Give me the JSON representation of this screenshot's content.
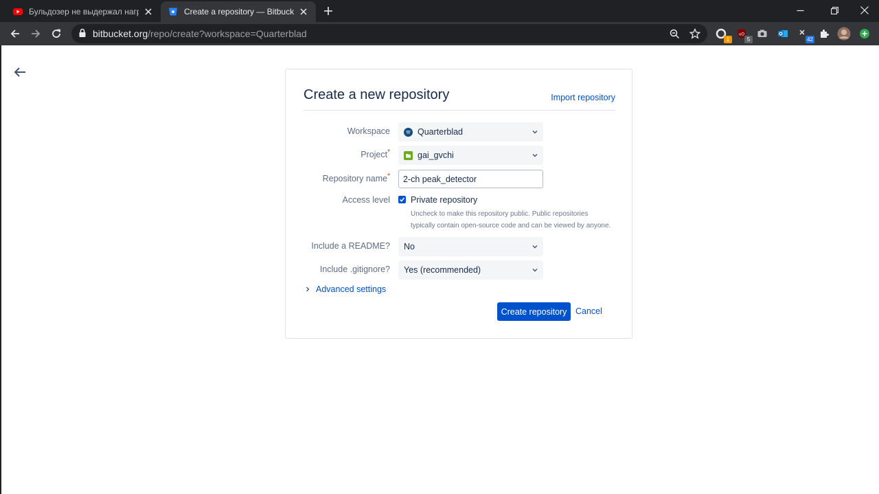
{
  "browser": {
    "tabs": [
      {
        "title": "Бульдозер не выдержал нагрузку",
        "active": false,
        "favicon": "youtube-icon"
      },
      {
        "title": "Create a repository — Bitbucket",
        "active": true,
        "favicon": "bitbucket-icon"
      }
    ],
    "url": {
      "host": "bitbucket.org",
      "path": "/repo/create?workspace=Quarterblad"
    },
    "extensions": [
      {
        "name": "extension-icon-1",
        "badge": "1"
      },
      {
        "name": "ublock-icon",
        "badge": "5"
      },
      {
        "name": "camera-icon",
        "badge": ""
      },
      {
        "name": "outlook-icon",
        "badge": ""
      },
      {
        "name": "extension-icon-42",
        "badge": "42"
      }
    ]
  },
  "form": {
    "title": "Create a new repository",
    "import_link": "Import repository",
    "workspace": {
      "label": "Workspace",
      "value": "Quarterblad"
    },
    "project": {
      "label": "Project",
      "value": "gai_gvchi",
      "required_mark": "*"
    },
    "repo_name": {
      "label": "Repository name",
      "value": "2-ch peak_detector",
      "required_mark": "*"
    },
    "access": {
      "label": "Access level",
      "checkbox_label": "Private repository",
      "checked": true,
      "help_line1": "Uncheck to make this repository public. Public repositories",
      "help_line2": "typically contain open-source code and can be viewed by anyone."
    },
    "readme": {
      "label": "Include a README?",
      "value": "No"
    },
    "gitignore": {
      "label": "Include .gitignore?",
      "value": "Yes (recommended)"
    },
    "advanced": "Advanced settings",
    "submit": "Create repository",
    "cancel": "Cancel"
  },
  "colors": {
    "primary": "#0052cc",
    "text": "#172b4d",
    "muted": "#5e6c84",
    "required": "#de350b"
  }
}
